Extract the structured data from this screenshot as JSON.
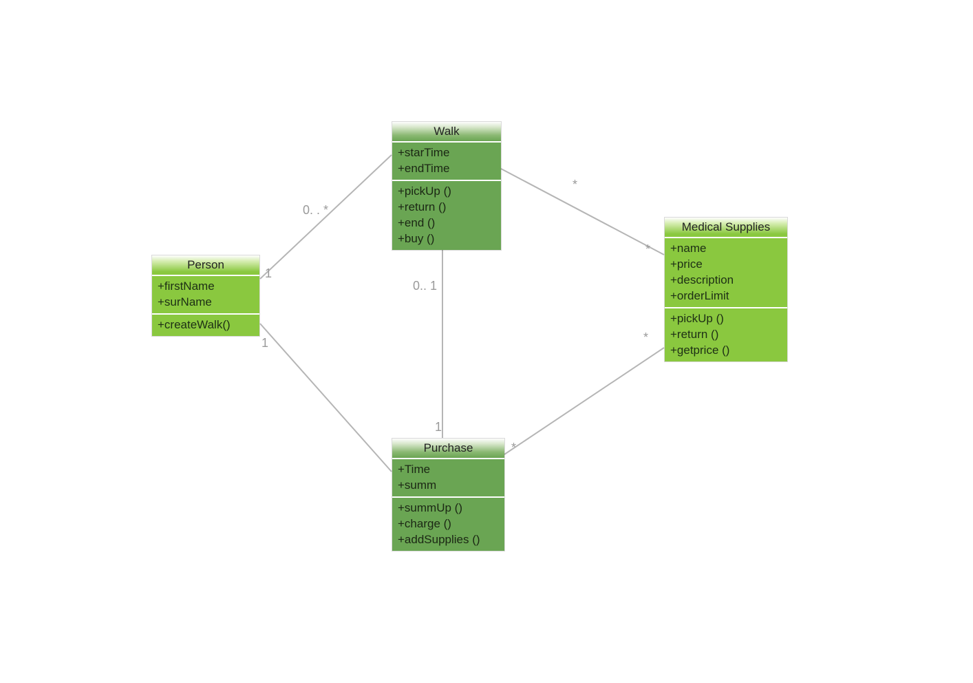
{
  "classes": {
    "person": {
      "title": "Person",
      "attributes": [
        "+firstName",
        "+surName"
      ],
      "methods": [
        "+createWalk()"
      ]
    },
    "walk": {
      "title": "Walk",
      "attributes": [
        "+starTime",
        "+endTime"
      ],
      "methods": [
        "+pickUp ()",
        "+return ()",
        "+end ()",
        "+buy ()"
      ]
    },
    "medical": {
      "title": "Medical Supplies",
      "attributes": [
        "+name",
        "+price",
        "+description",
        "+orderLimit"
      ],
      "methods": [
        "+pickUp ()",
        "+return ()",
        "+getprice ()"
      ]
    },
    "purchase": {
      "title": "Purchase",
      "attributes": [
        "+Time",
        "+summ"
      ],
      "methods": [
        "+summUp ()",
        "+charge ()",
        "+addSupplies ()"
      ]
    }
  },
  "multiplicities": {
    "person_walk_personSide": "1",
    "person_walk_walkSide": "0. . *",
    "person_purchase_personSide": "1",
    "walk_purchase_walkSide": "0.. 1",
    "walk_purchase_purchaseSide": "1",
    "walk_medical_walkSide": "*",
    "walk_medical_medicalSide": "*",
    "purchase_medical_purchaseSide": "*",
    "purchase_medical_medicalSide": "*"
  },
  "associations": [
    {
      "from": "person",
      "to": "walk",
      "mult_from": "1",
      "mult_to": "0. . *"
    },
    {
      "from": "person",
      "to": "purchase",
      "mult_from": "1",
      "mult_to": ""
    },
    {
      "from": "walk",
      "to": "purchase",
      "mult_from": "0.. 1",
      "mult_to": "1"
    },
    {
      "from": "walk",
      "to": "medical",
      "mult_from": "*",
      "mult_to": "*"
    },
    {
      "from": "purchase",
      "to": "medical",
      "mult_from": "*",
      "mult_to": "*"
    }
  ]
}
